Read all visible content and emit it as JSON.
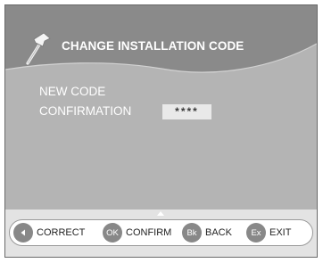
{
  "header": {
    "title": "CHANGE INSTALLATION CODE",
    "icon": "hammer-icon"
  },
  "form": {
    "new_code_label": "NEW CODE",
    "confirmation_label": "CONFIRMATION",
    "confirmation_value": "****"
  },
  "footer": {
    "keys": [
      {
        "badge": "",
        "icon": "left-arrow-icon",
        "label": "CORRECT"
      },
      {
        "badge": "OK",
        "label": "CONFIRM"
      },
      {
        "badge": "Bk",
        "label": "BACK"
      },
      {
        "badge": "Ex",
        "label": "EXIT"
      }
    ]
  },
  "colors": {
    "panel": "#b4b4b4",
    "header_band": "#8a8a8a",
    "badge": "#888888",
    "footer_bar": "#e3e3e3"
  }
}
